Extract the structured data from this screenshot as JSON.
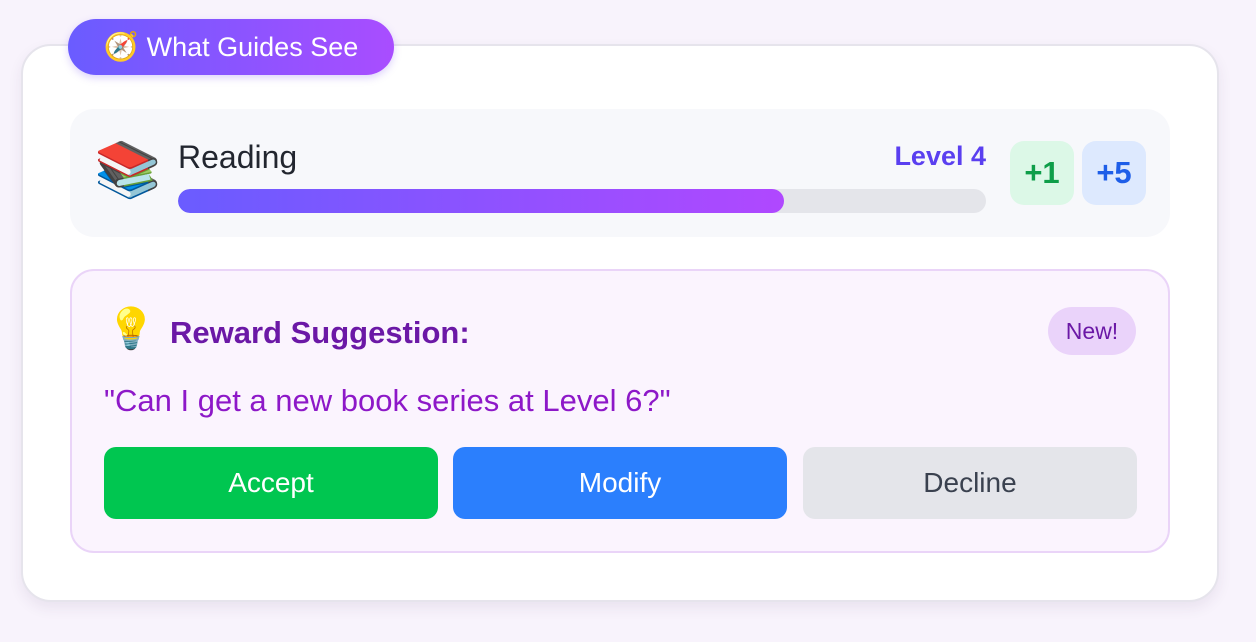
{
  "header": {
    "icon": "compass-icon",
    "icon_glyph": "🧭",
    "title": "What Guides See"
  },
  "skill": {
    "icon": "books-icon",
    "icon_glyph": "📚",
    "name": "Reading",
    "level": "Level 4",
    "progress_percent": 75,
    "points": [
      "+1",
      "+5"
    ]
  },
  "suggestion": {
    "icon": "lightbulb-icon",
    "icon_glyph": "💡",
    "title": "Reward Suggestion:",
    "badge": "New!",
    "quote": "\"Can I get a new book series at Level 6?\"",
    "actions": {
      "accept": "Accept",
      "modify": "Modify",
      "decline": "Decline"
    }
  },
  "colors": {
    "accent_gradient_start": "#6a5cff",
    "accent_gradient_end": "#a94dff",
    "accept": "#00c650",
    "modify": "#2b7ffd",
    "decline": "#e4e5ea",
    "level_text": "#5a3ff0",
    "suggestion_title": "#6b18a6"
  }
}
